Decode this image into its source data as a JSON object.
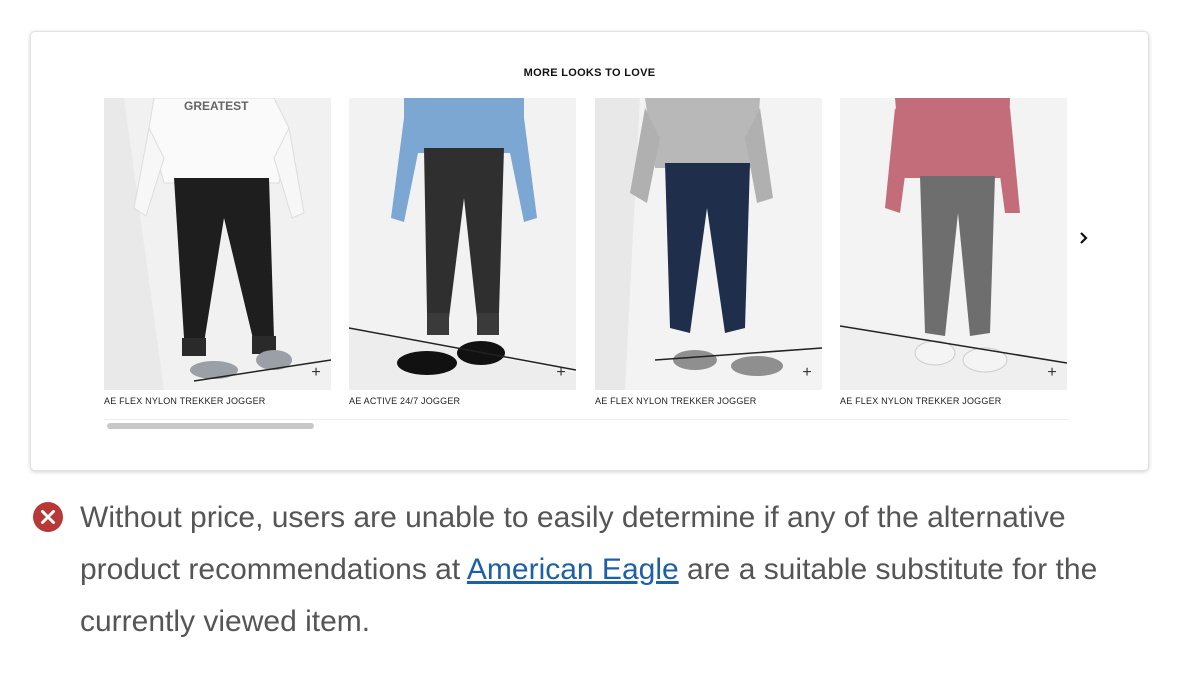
{
  "carousel": {
    "title": "MORE LOOKS TO LOVE",
    "products": [
      {
        "name": "AE FLEX NYLON TREKKER JOGGER",
        "add_label": "+",
        "image_desc": "black-jogger-photo",
        "sweatshirt_text": "GREATEST"
      },
      {
        "name": "AE ACTIVE 24/7 JOGGER",
        "add_label": "+",
        "image_desc": "charcoal-jogger-photo"
      },
      {
        "name": "AE FLEX NYLON TREKKER JOGGER",
        "add_label": "+",
        "image_desc": "navy-jogger-photo"
      },
      {
        "name": "AE FLEX NYLON TREKKER JOGGER",
        "add_label": "+",
        "image_desc": "gray-jogger-photo"
      }
    ],
    "next_icon": "chevron-right-icon",
    "scroll_position": 0.2
  },
  "note": {
    "icon": "error-x-icon",
    "icon_color": "#b83737",
    "text_before": "Without price, users are unable to easily determine if any of the alternative product recommendations at ",
    "link_text": "American Eagle",
    "text_after": " are a suitable substitute for the currently viewed item."
  }
}
